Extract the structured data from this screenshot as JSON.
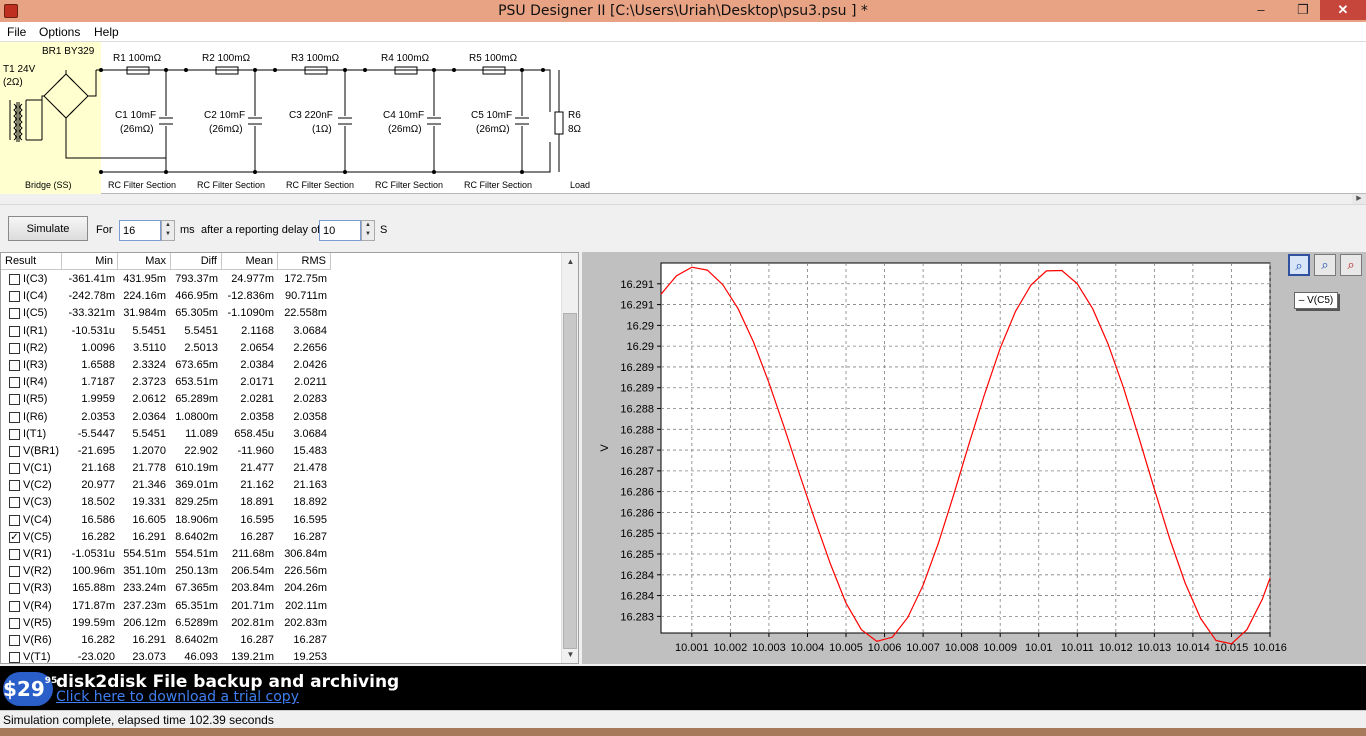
{
  "window": {
    "title": "PSU Designer II  [C:\\Users\\Uriah\\Desktop\\psu3.psu ] *",
    "minimize": "–",
    "maximize": "❐",
    "close": "✕"
  },
  "menu": [
    "File",
    "Options",
    "Help"
  ],
  "circuit": {
    "labels": {
      "bridge": "BR1 BY329",
      "transformer": "T1 24V",
      "transformer_r": "(2Ω)",
      "r1": "R1 100mΩ",
      "r2": "R2 100mΩ",
      "r3": "R3 100mΩ",
      "r4": "R4 100mΩ",
      "r5": "R5 100mΩ",
      "c1a": "C1 10mF",
      "c1b": "(26mΩ)",
      "c2a": "C2 10mF",
      "c2b": "(26mΩ)",
      "c3a": "C3 220nF",
      "c3b": "(1Ω)",
      "c4a": "C4 10mF",
      "c4b": "(26mΩ)",
      "c5a": "C5 10mF",
      "c5b": "(26mΩ)",
      "r6a": "R6",
      "r6b": "8Ω"
    },
    "sections": {
      "bridge": "Bridge (SS)",
      "rc1": "RC Filter Section",
      "rc2": "RC Filter Section",
      "rc3": "RC Filter Section",
      "rc4": "RC Filter Section",
      "rc5": "RC Filter Section",
      "load": "Load"
    }
  },
  "controls": {
    "simulate": "Simulate",
    "for": "For",
    "duration": "16",
    "ms": "ms",
    "after": "after a reporting delay of",
    "delay": "10",
    "s": "S"
  },
  "table": {
    "headers": [
      "Result",
      "Min",
      "Max",
      "Diff",
      "Mean",
      "RMS"
    ],
    "rows": [
      {
        "name": "I(C3)",
        "checked": false,
        "v": [
          "-361.41m",
          "431.95m",
          "793.37m",
          "24.977m",
          "172.75m"
        ]
      },
      {
        "name": "I(C4)",
        "checked": false,
        "v": [
          "-242.78m",
          "224.16m",
          "466.95m",
          "-12.836m",
          "90.711m"
        ]
      },
      {
        "name": "I(C5)",
        "checked": false,
        "v": [
          "-33.321m",
          "31.984m",
          "65.305m",
          "-1.1090m",
          "22.558m"
        ]
      },
      {
        "name": "I(R1)",
        "checked": false,
        "v": [
          "-10.531u",
          "5.5451",
          "5.5451",
          "2.1168",
          "3.0684"
        ]
      },
      {
        "name": "I(R2)",
        "checked": false,
        "v": [
          "1.0096",
          "3.5110",
          "2.5013",
          "2.0654",
          "2.2656"
        ]
      },
      {
        "name": "I(R3)",
        "checked": false,
        "v": [
          "1.6588",
          "2.3324",
          "673.65m",
          "2.0384",
          "2.0426"
        ]
      },
      {
        "name": "I(R4)",
        "checked": false,
        "v": [
          "1.7187",
          "2.3723",
          "653.51m",
          "2.0171",
          "2.0211"
        ]
      },
      {
        "name": "I(R5)",
        "checked": false,
        "v": [
          "1.9959",
          "2.0612",
          "65.289m",
          "2.0281",
          "2.0283"
        ]
      },
      {
        "name": "I(R6)",
        "checked": false,
        "v": [
          "2.0353",
          "2.0364",
          "1.0800m",
          "2.0358",
          "2.0358"
        ]
      },
      {
        "name": "I(T1)",
        "checked": false,
        "v": [
          "-5.5447",
          "5.5451",
          "11.089",
          "658.45u",
          "3.0684"
        ]
      },
      {
        "name": "V(BR1)",
        "checked": false,
        "v": [
          "-21.695",
          "1.2070",
          "22.902",
          "-11.960",
          "15.483"
        ]
      },
      {
        "name": "V(C1)",
        "checked": false,
        "v": [
          "21.168",
          "21.778",
          "610.19m",
          "21.477",
          "21.478"
        ]
      },
      {
        "name": "V(C2)",
        "checked": false,
        "v": [
          "20.977",
          "21.346",
          "369.01m",
          "21.162",
          "21.163"
        ]
      },
      {
        "name": "V(C3)",
        "checked": false,
        "v": [
          "18.502",
          "19.331",
          "829.25m",
          "18.891",
          "18.892"
        ]
      },
      {
        "name": "V(C4)",
        "checked": false,
        "v": [
          "16.586",
          "16.605",
          "18.906m",
          "16.595",
          "16.595"
        ]
      },
      {
        "name": "V(C5)",
        "checked": true,
        "v": [
          "16.282",
          "16.291",
          "8.6402m",
          "16.287",
          "16.287"
        ]
      },
      {
        "name": "V(R1)",
        "checked": false,
        "v": [
          "-1.0531u",
          "554.51m",
          "554.51m",
          "211.68m",
          "306.84m"
        ]
      },
      {
        "name": "V(R2)",
        "checked": false,
        "v": [
          "100.96m",
          "351.10m",
          "250.13m",
          "206.54m",
          "226.56m"
        ]
      },
      {
        "name": "V(R3)",
        "checked": false,
        "v": [
          "165.88m",
          "233.24m",
          "67.365m",
          "203.84m",
          "204.26m"
        ]
      },
      {
        "name": "V(R4)",
        "checked": false,
        "v": [
          "171.87m",
          "237.23m",
          "65.351m",
          "201.71m",
          "202.11m"
        ]
      },
      {
        "name": "V(R5)",
        "checked": false,
        "v": [
          "199.59m",
          "206.12m",
          "6.5289m",
          "202.81m",
          "202.83m"
        ]
      },
      {
        "name": "V(R6)",
        "checked": false,
        "v": [
          "16.282",
          "16.291",
          "8.6402m",
          "16.287",
          "16.287"
        ]
      },
      {
        "name": "V(T1)",
        "checked": false,
        "v": [
          "-23.020",
          "23.073",
          "46.093",
          "139.21m",
          "19.253"
        ]
      }
    ]
  },
  "chart_data": {
    "type": "line",
    "ylabel": "V",
    "xlabel": "",
    "xlim": [
      10.0002,
      10.016
    ],
    "ylim": [
      16.2826,
      16.2915
    ],
    "x_ticks": [
      "10.001",
      "10.002",
      "10.003",
      "10.004",
      "10.005",
      "10.006",
      "10.007",
      "10.008",
      "10.009",
      "10.01",
      "10.011",
      "10.012",
      "10.013",
      "10.014",
      "10.015",
      "10.016"
    ],
    "x_tick_values": [
      10.001,
      10.002,
      10.003,
      10.004,
      10.005,
      10.006,
      10.007,
      10.008,
      10.009,
      10.01,
      10.011,
      10.012,
      10.013,
      10.014,
      10.015,
      10.016
    ],
    "y_ticks": [
      "16.291",
      "16.291",
      "16.29",
      "16.29",
      "16.289",
      "16.289",
      "16.288",
      "16.288",
      "16.287",
      "16.287",
      "16.286",
      "16.286",
      "16.285",
      "16.285",
      "16.284",
      "16.284",
      "16.283"
    ],
    "y_tick_values": [
      16.291,
      16.2905,
      16.29,
      16.2895,
      16.289,
      16.2885,
      16.288,
      16.2875,
      16.287,
      16.2865,
      16.286,
      16.2855,
      16.285,
      16.2845,
      16.284,
      16.2835,
      16.283
    ],
    "grid": true,
    "legend": "top-right",
    "series": [
      {
        "name": "V(C5)",
        "color": "#ff0000",
        "x": [
          10.0002,
          10.0006,
          10.001,
          10.0014,
          10.0018,
          10.0022,
          10.0026,
          10.003,
          10.0034,
          10.0038,
          10.0042,
          10.0046,
          10.005,
          10.0054,
          10.0058,
          10.0062,
          10.0066,
          10.007,
          10.0074,
          10.0078,
          10.0082,
          10.0086,
          10.009,
          10.0094,
          10.0098,
          10.0102,
          10.0106,
          10.011,
          10.0114,
          10.0118,
          10.0122,
          10.0126,
          10.013,
          10.0134,
          10.0138,
          10.0142,
          10.0146,
          10.015,
          10.0154,
          10.0158,
          10.016
        ],
        "y": [
          16.29075,
          16.29119,
          16.2914,
          16.29133,
          16.29098,
          16.2904,
          16.2896,
          16.28862,
          16.28754,
          16.2864,
          16.2853,
          16.28425,
          16.28332,
          16.28268,
          16.2824,
          16.2825,
          16.28297,
          16.28375,
          16.28477,
          16.28594,
          16.28718,
          16.28836,
          16.28945,
          16.29034,
          16.29097,
          16.29131,
          16.29132,
          16.291,
          16.2904,
          16.28955,
          16.2885,
          16.2873,
          16.28606,
          16.28486,
          16.2838,
          16.28295,
          16.28242,
          16.28234,
          16.28268,
          16.28341,
          16.28392
        ]
      }
    ]
  },
  "legend_label": "– V(C5)",
  "banner": {
    "price": "$29",
    "price_sup": "95",
    "headline": "disk2disk File backup and archiving",
    "link": "Click here to download a trial copy"
  },
  "status": "Simulation complete, elapsed time 102.39 seconds"
}
